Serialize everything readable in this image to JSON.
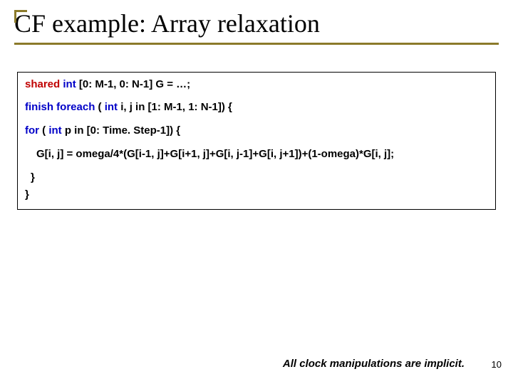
{
  "title": "CF example: Array relaxation",
  "code": {
    "l1_shared": "shared",
    "l1_int": "int",
    "l1_rest": " [0: M-1, 0: N-1] G = …;",
    "l2_finish": "finish",
    "l2_foreach": "foreach",
    "l2_paren": " (",
    "l2_int": "int",
    "l2_rest": " i, j in [1: M-1, 1: N-1]) {",
    "l3_for": "for",
    "l3_paren": " (",
    "l3_int": "int",
    "l3_rest": " p in [0: Time. Step-1]) {",
    "l4": "G[i, j] = omega/4*(G[i-1, j]+G[i+1, j]+G[i, j-1]+G[i, j+1])+(1-omega)*G[i, j];",
    "l5": "}",
    "l6": "}"
  },
  "footer": "All clock manipulations are implicit.",
  "page": "10"
}
